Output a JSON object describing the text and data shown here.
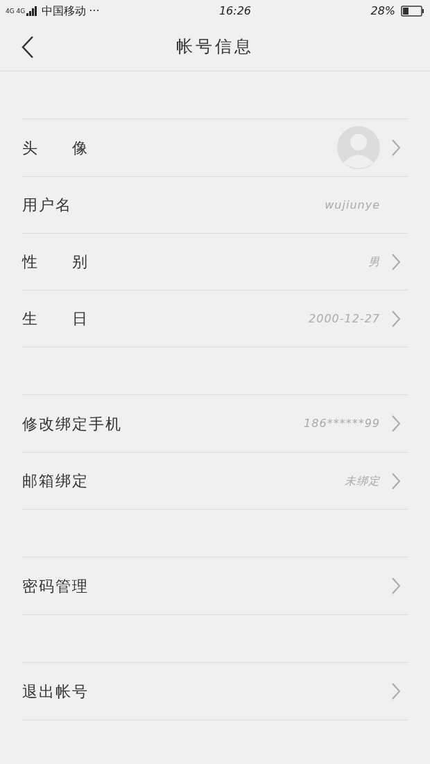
{
  "status_bar": {
    "network": "4G 4G",
    "carrier": "中国移动",
    "more": "···",
    "time": "16:26",
    "battery": "28%"
  },
  "header": {
    "title": "帐号信息"
  },
  "groups": [
    {
      "rows": [
        {
          "kind": "avatar",
          "label": "头　　像",
          "chevron": true
        },
        {
          "kind": "text",
          "label": "用户名",
          "value": "wujiunye",
          "chevron": false
        },
        {
          "kind": "text",
          "label": "性　　别",
          "value": "男",
          "chevron": true
        },
        {
          "kind": "text",
          "label": "生　　日",
          "value": "2000-12-27",
          "chevron": true
        }
      ]
    },
    {
      "rows": [
        {
          "kind": "text",
          "label": "修改绑定手机",
          "value": "186******99",
          "chevron": true
        },
        {
          "kind": "text",
          "label": "邮箱绑定",
          "value": "未绑定",
          "chevron": true
        }
      ]
    },
    {
      "rows": [
        {
          "kind": "text",
          "label": "密码管理",
          "chevron": true
        }
      ]
    },
    {
      "rows": [
        {
          "kind": "text",
          "label": "退出帐号",
          "chevron": true
        }
      ]
    }
  ]
}
